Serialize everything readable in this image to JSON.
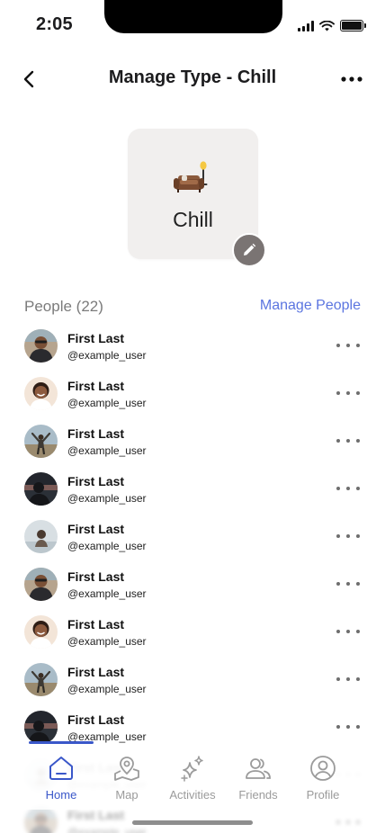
{
  "status_bar": {
    "time": "2:05"
  },
  "header": {
    "title": "Manage Type - Chill"
  },
  "type_card": {
    "name": "Chill",
    "icon": "couch-lamp-emoji"
  },
  "people": {
    "count_label": "People (22)",
    "manage_label": "Manage People",
    "items": [
      {
        "name": "First Last",
        "handle": "@example_user",
        "avatar": "man-sunglasses"
      },
      {
        "name": "First Last",
        "handle": "@example_user",
        "avatar": "woman-smiling"
      },
      {
        "name": "First Last",
        "handle": "@example_user",
        "avatar": "man-arms-raised"
      },
      {
        "name": "First Last",
        "handle": "@example_user",
        "avatar": "silhouette-sunset"
      },
      {
        "name": "First Last",
        "handle": "@example_user",
        "avatar": "person-water"
      },
      {
        "name": "First Last",
        "handle": "@example_user",
        "avatar": "man-sunglasses"
      },
      {
        "name": "First Last",
        "handle": "@example_user",
        "avatar": "woman-smiling"
      },
      {
        "name": "First Last",
        "handle": "@example_user",
        "avatar": "man-arms-raised"
      },
      {
        "name": "First Last",
        "handle": "@example_user",
        "avatar": "silhouette-sunset"
      },
      {
        "name": "First Last",
        "handle": "@example_user",
        "avatar": "person-water"
      },
      {
        "name": "First Last",
        "handle": "@example_user",
        "avatar": "man-sunglasses"
      }
    ]
  },
  "tabs": [
    {
      "label": "Home",
      "icon": "home-icon",
      "active": true
    },
    {
      "label": "Map",
      "icon": "map-pin-icon",
      "active": false
    },
    {
      "label": "Activities",
      "icon": "sparkles-icon",
      "active": false
    },
    {
      "label": "Friends",
      "icon": "friends-icon",
      "active": false
    },
    {
      "label": "Profile",
      "icon": "profile-icon",
      "active": false
    }
  ],
  "colors": {
    "accent": "#3a57c9",
    "link": "#5b75e0",
    "card": "#f1efee",
    "edit_button": "#7a7473"
  }
}
